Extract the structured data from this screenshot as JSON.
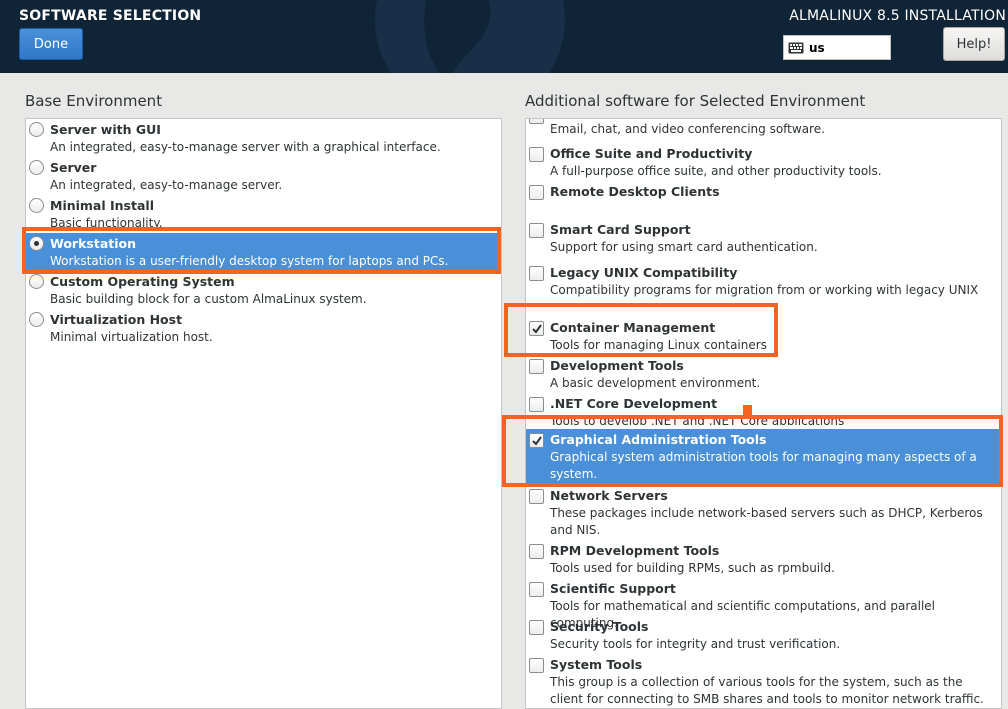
{
  "header": {
    "title": "SOFTWARE SELECTION",
    "done_label": "Done",
    "install_title": "ALMALINUX 8.5 INSTALLATION",
    "keyboard_layout": "us",
    "help_label": "Help!",
    "background_color": "#0f2436",
    "done_color": "#3c85d3"
  },
  "base_env": {
    "label": "Base Environment",
    "items": [
      {
        "name": "Server with GUI",
        "desc": "An integrated, easy-to-manage server with a graphical interface.",
        "checked": false
      },
      {
        "name": "Server",
        "desc": "An integrated, easy-to-manage server.",
        "checked": false
      },
      {
        "name": "Minimal Install",
        "desc": "Basic functionality.",
        "checked": false
      },
      {
        "name": "Workstation",
        "desc": "Workstation is a user-friendly desktop system for laptops and PCs.",
        "checked": true
      },
      {
        "name": "Custom Operating System",
        "desc": "Basic building block for a custom AlmaLinux system.",
        "checked": false
      },
      {
        "name": "Virtualization Host",
        "desc": "Minimal virtualization host.",
        "checked": false
      }
    ]
  },
  "addons": {
    "label": "Additional software for Selected Environment",
    "items": [
      {
        "name": "",
        "desc": "Email, chat, and video conferencing software.",
        "checked": false
      },
      {
        "name": "Office Suite and Productivity",
        "desc": "A full-purpose office suite, and other productivity tools.",
        "checked": false
      },
      {
        "name": "Remote Desktop Clients",
        "desc": "",
        "checked": false
      },
      {
        "name": "Smart Card Support",
        "desc": "Support for using smart card authentication.",
        "checked": false
      },
      {
        "name": "Legacy UNIX Compatibility",
        "desc": "Compatibility programs for migration from or working with legacy UNIX environments.",
        "checked": false
      },
      {
        "name": "Container Management",
        "desc": "Tools for managing Linux containers",
        "checked": true
      },
      {
        "name": "Development Tools",
        "desc": "A basic development environment.",
        "checked": false
      },
      {
        "name": ".NET Core Development",
        "desc": "Tools to develop .NET and .NET Core applications",
        "checked": false
      },
      {
        "name": "Graphical Administration Tools",
        "desc": "Graphical system administration tools for managing many aspects of a system.",
        "checked": true
      },
      {
        "name": "Network Servers",
        "desc": "These packages include network-based servers such as DHCP, Kerberos and NIS.",
        "checked": false
      },
      {
        "name": "RPM Development Tools",
        "desc": "Tools used for building RPMs, such as rpmbuild.",
        "checked": false
      },
      {
        "name": "Scientific Support",
        "desc": "Tools for mathematical and scientific computations, and parallel computing.",
        "checked": false
      },
      {
        "name": "Security Tools",
        "desc": "Security tools for integrity and trust verification.",
        "checked": false
      },
      {
        "name": "System Tools",
        "desc": "This group is a collection of various tools for the system, such as the client for connecting to SMB shares and tools to monitor network traffic.",
        "checked": false
      }
    ]
  },
  "colors": {
    "selection": "#4a90d9",
    "highlight": "#f5641e"
  }
}
